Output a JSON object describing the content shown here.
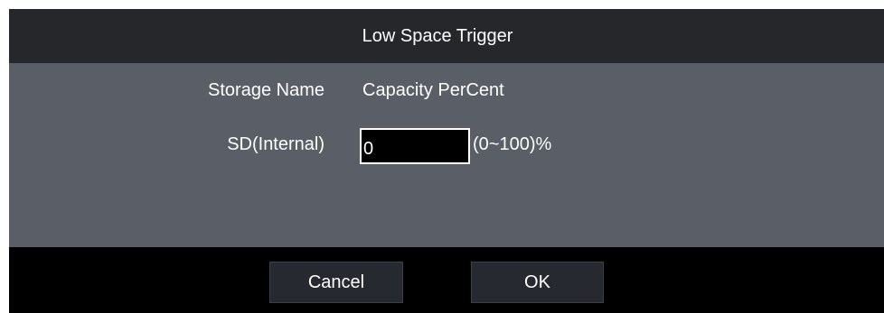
{
  "dialog": {
    "title": "Low Space Trigger"
  },
  "table": {
    "headers": {
      "storage_name": "Storage Name",
      "capacity": "Capacity PerCent"
    },
    "rows": [
      {
        "storage_name": "SD(Internal)",
        "capacity_value": "0",
        "unit": "(0~100)%"
      }
    ]
  },
  "buttons": {
    "cancel": "Cancel",
    "ok": "OK"
  },
  "colors": {
    "titlebar": "#25272b",
    "body": "#5a5e66",
    "footer": "#000000",
    "button": "#262a30",
    "text": "#ffffff"
  }
}
